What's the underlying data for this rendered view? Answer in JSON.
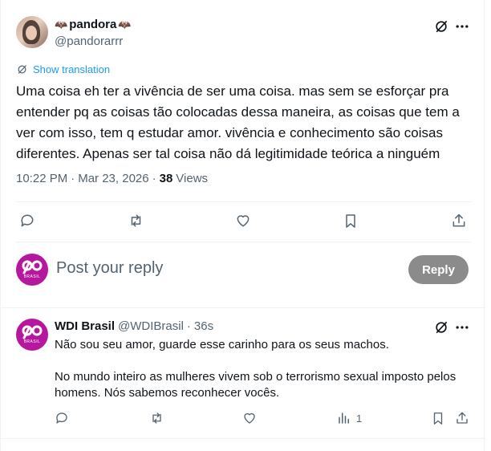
{
  "post": {
    "display_name": "pandora",
    "handle": "@pandorarrr",
    "show_translation": "Show translation",
    "body_lines": [
      "Uma coisa eh ter a vivência de ser uma coisa. mas sem se esforçar pra",
      "entender pq as coisas tão colocadas dessa maneira, as coisas que tem a",
      "ver com isso, tem q estudar amor. vivência e conhecimento são coisas",
      "diferentes. Apenas ser tal coisa não dá legitimidade teórica a ninguém"
    ],
    "time": "10:22 PM",
    "separator": "·",
    "date": "Mar 23, 2026",
    "views_count": "38",
    "views_label": "Views"
  },
  "composer": {
    "placeholder": "Post your reply",
    "reply_button": "Reply",
    "avatar_text": "BRASIL"
  },
  "reply": {
    "display_name": "WDI Brasil",
    "handle": "@WDIBrasil",
    "separator": "·",
    "age": "36s",
    "avatar_text": "BRASIL",
    "line1": "Não sou seu amor, guarde esse carinho para os seus machos.",
    "line2": "No mundo inteiro as mulheres vivem sob o terrorismo sexual imposto pelos",
    "line3": "homens. Nós sabemos reconhecer vocês.",
    "analytics_count": "1"
  },
  "colors": {
    "brand_magenta": "#b5179e",
    "link_blue": "#1d9bf0",
    "muted_gray": "#536471",
    "reply_button_bg": "#8b8b8b"
  }
}
